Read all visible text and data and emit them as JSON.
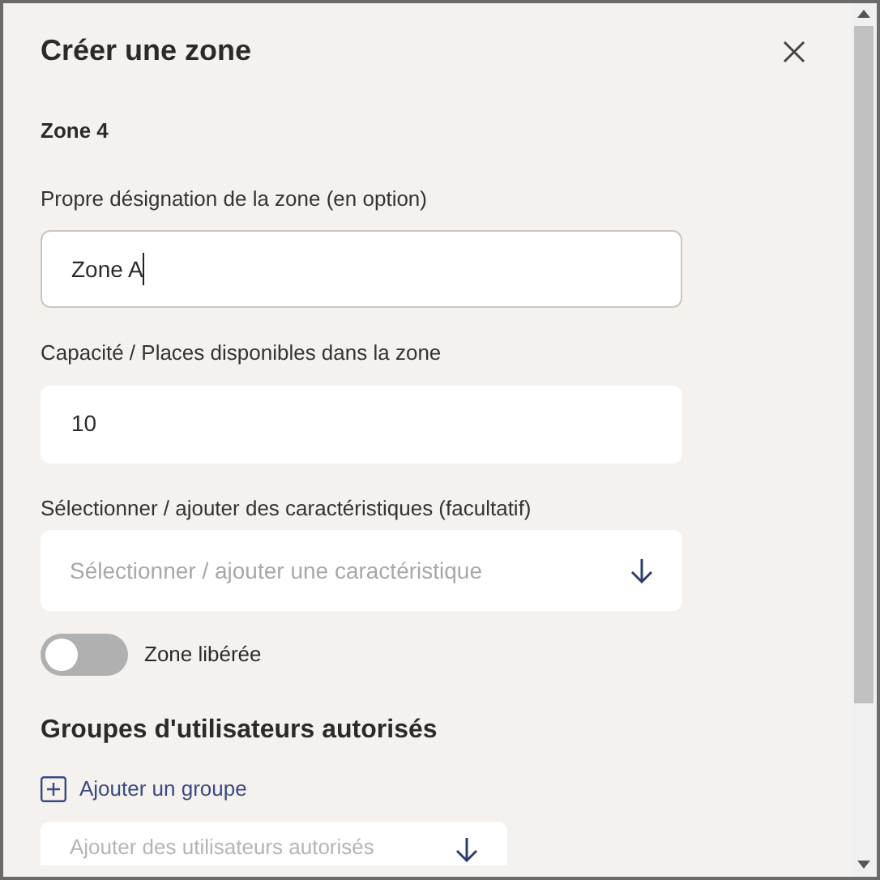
{
  "dialog": {
    "title": "Créer une zone",
    "subtitle": "Zone 4"
  },
  "fields": [
    {
      "kind": "input",
      "label": "Propre désignation de la zone (en option)",
      "value": "Zone A",
      "focused": true
    },
    {
      "kind": "input",
      "label": "Capacité / Places disponibles dans la zone",
      "value": "10",
      "focused": false
    },
    {
      "kind": "select",
      "label": "Sélectionner / ajouter des caractéristiques (facultatif)",
      "placeholder": "Sélectionner / ajouter une caractéristique"
    }
  ],
  "toggle": {
    "label": "Zone libérée",
    "on": false
  },
  "groups": {
    "heading": "Groupes d'utilisateurs autorisés",
    "add_link": "Ajouter un groupe",
    "select": {
      "placeholder": "Ajouter des utilisateurs autorisés"
    }
  }
}
